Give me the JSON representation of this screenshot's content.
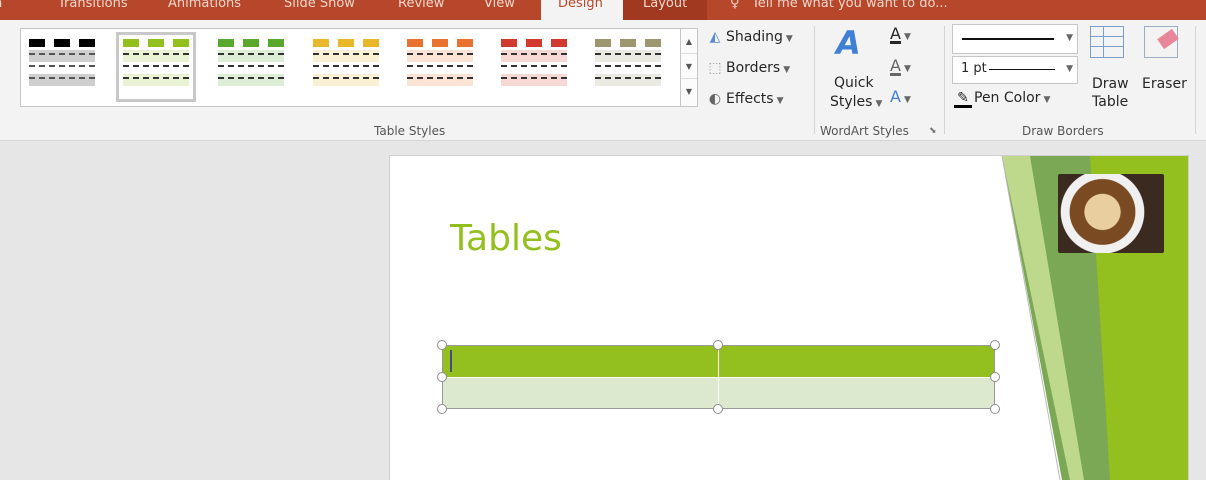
{
  "tabs": {
    "transitions": "Transitions",
    "animations": "Animations",
    "slide_show": "Slide Show",
    "review": "Review",
    "view": "View",
    "design": "Design",
    "layout": "Layout",
    "tell_me": "Tell me what you want to do..."
  },
  "ribbon": {
    "table_styles": {
      "label": "Table Styles",
      "swatch_colors": [
        "#000000",
        "#92c01f",
        "#5aa72e",
        "#e8b72a",
        "#e9722e",
        "#d13a2e",
        "#9d966e"
      ],
      "shading": "Shading",
      "borders": "Borders",
      "effects": "Effects"
    },
    "wordart": {
      "label": "WordArt Styles",
      "quick_styles_line1": "Quick",
      "quick_styles_line2": "Styles"
    },
    "draw_borders": {
      "label": "Draw Borders",
      "pen_weight": "1 pt",
      "pen_color": "Pen Color",
      "draw_table_line1": "Draw",
      "draw_table_line2": "Table",
      "eraser": "Eraser"
    }
  },
  "slide": {
    "title": "Tables",
    "accent": "#93c01f"
  }
}
